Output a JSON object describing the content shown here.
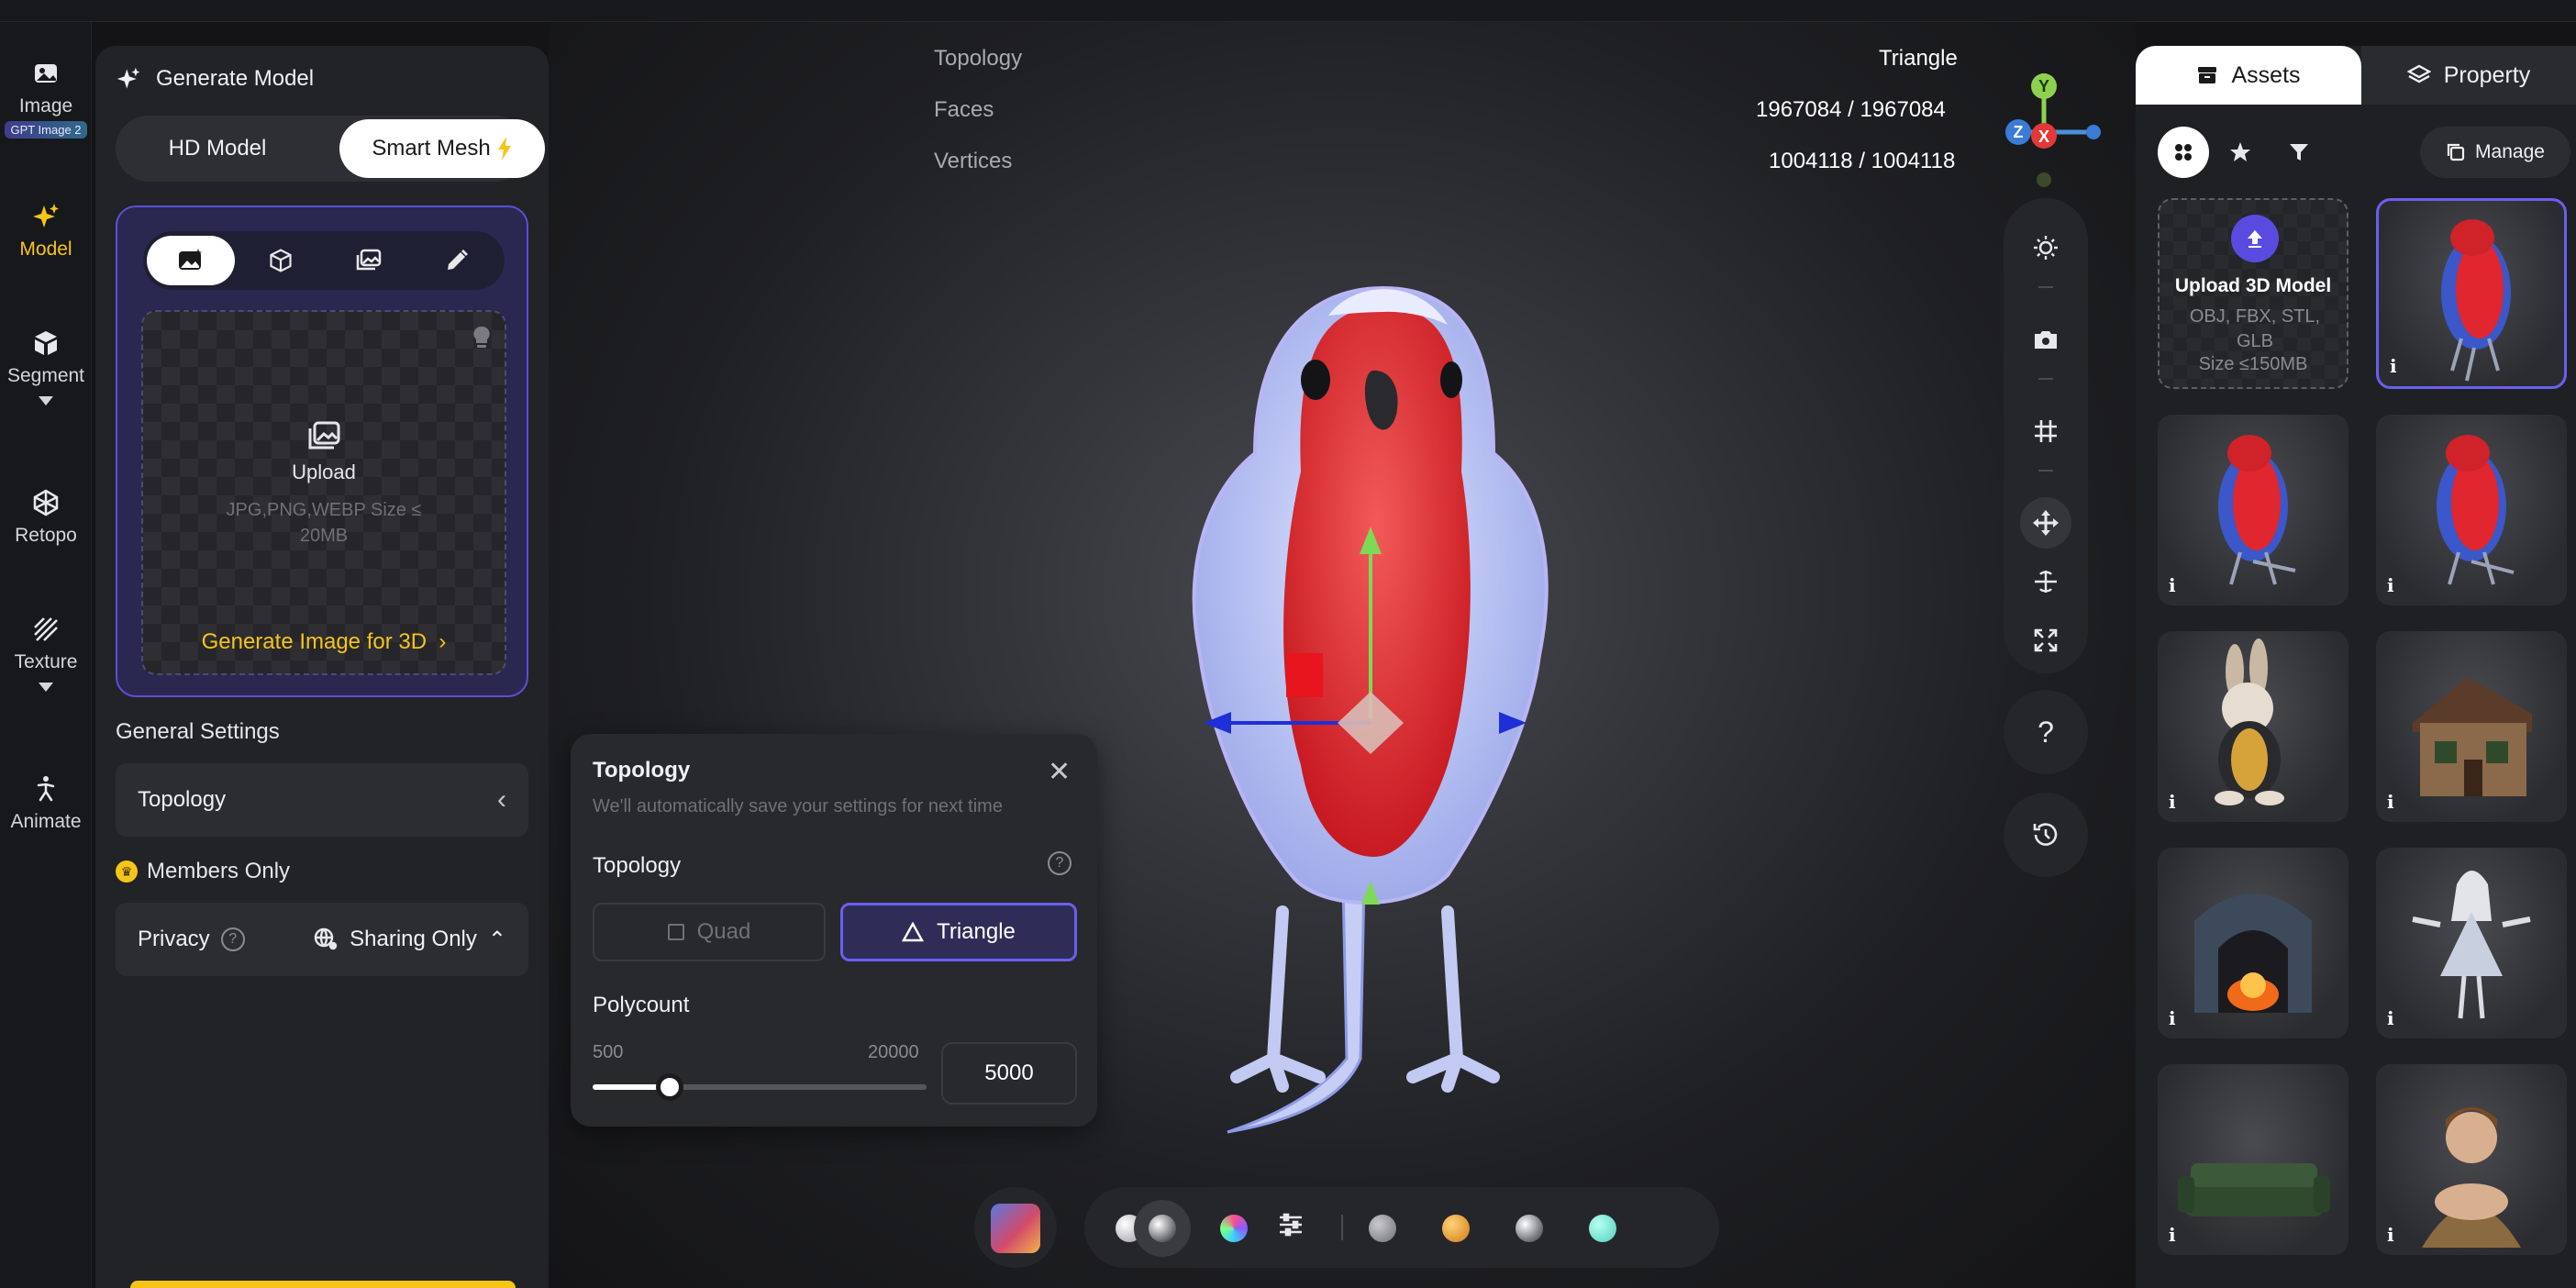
{
  "rail": {
    "items": [
      {
        "label": "Image",
        "badge": "GPT Image 2"
      },
      {
        "label": "Model"
      },
      {
        "label": "Segment"
      },
      {
        "label": "Retopo"
      },
      {
        "label": "Texture"
      },
      {
        "label": "Animate"
      }
    ]
  },
  "left_panel": {
    "title": "Generate Model",
    "mode_tabs": {
      "hd": "HD Model",
      "smart": "Smart Mesh"
    },
    "upload": {
      "label": "Upload",
      "hint": "JPG,PNG,WEBP Size ≤ 20MB",
      "generate_link": "Generate Image for 3D"
    },
    "general_settings_label": "General Settings",
    "topology_row": "Topology",
    "members_only": "Members Only",
    "privacy_label": "Privacy",
    "privacy_value": "Sharing Only"
  },
  "stats": {
    "topology_label": "Topology",
    "topology_value": "Triangle",
    "faces_label": "Faces",
    "faces_value": "1967084 / 1967084",
    "vertices_label": "Vertices",
    "vertices_value": "1004118 / 1004118"
  },
  "axis": {
    "y": "Y",
    "z": "Z",
    "x": "X"
  },
  "topology_popup": {
    "title": "Topology",
    "subtitle": "We'll automatically save your settings for next time",
    "section_label": "Topology",
    "options": {
      "quad": "Quad",
      "triangle": "Triangle"
    },
    "selected": "Triangle",
    "polycount_label": "Polycount",
    "min_label": "500",
    "max_label": "20000",
    "min": 500,
    "max": 20000,
    "value": "5000"
  },
  "right_panel": {
    "tabs": {
      "assets": "Assets",
      "property": "Property"
    },
    "manage": "Manage",
    "upload": {
      "title": "Upload 3D Model",
      "formats": "OBJ, FBX, STL, GLB",
      "size": "Size ≤150MB"
    },
    "info_glyph": "i"
  },
  "help_glyph": "?",
  "colors": {
    "accent": "#f5c518",
    "brand_purple": "#6a5ff0",
    "panel": "#222327",
    "gizmo_y": "#8fd14f",
    "gizmo_x": "#1e2fd8"
  }
}
